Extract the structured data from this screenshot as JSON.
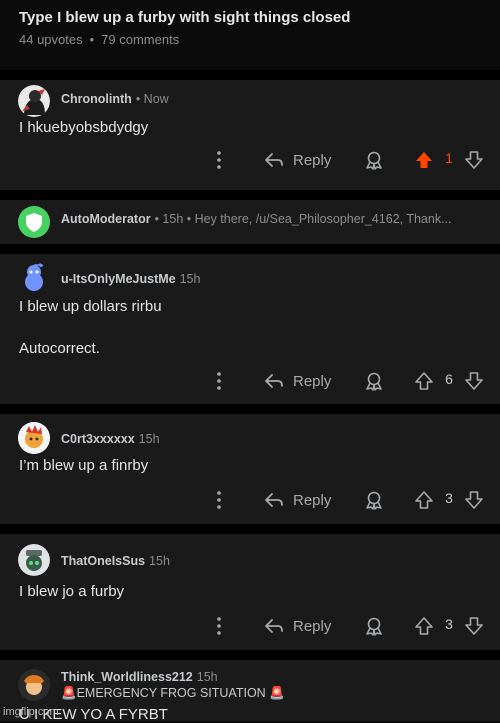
{
  "post": {
    "title": "Type I blew up a furby with sight things closed",
    "upvotes": "44 upvotes",
    "comments": "79 comments"
  },
  "reply_label": "Reply",
  "comments": [
    {
      "author": "Chronolinth",
      "time": "• Now",
      "lines": [
        "I hkuebyobsbdydgy"
      ],
      "votes": "1",
      "upvoted": true
    },
    {
      "author": "AutoModerator",
      "time": "• 15h • Hey there, /u/Sea_Philosopher_4162, Thank..."
    },
    {
      "author": "u-ItsOnlyMeJustMe",
      "time": "15h",
      "lines": [
        "I blew up dollars rirbu",
        "Autocorrect."
      ],
      "votes": "6"
    },
    {
      "author": "C0rt3xxxxxx",
      "time": "15h",
      "lines": [
        "I’m blew up a finrby"
      ],
      "votes": "3"
    },
    {
      "author": "ThatOneIsSus",
      "time": "15h",
      "lines": [
        "I blew jo a furby"
      ],
      "votes": "3"
    },
    {
      "author": "Think_Worldliness212",
      "time": "15h",
      "flair": "🚨EMERGENCY FROG SITUATION 🚨",
      "lines": [
        "U I KEW YO A FYRBT"
      ]
    }
  ],
  "watermark": "imgflip.com",
  "colors": {
    "upvote_active": "#ff4500",
    "automod_green": "#46d160",
    "card_bg": "#1a1a1b"
  }
}
